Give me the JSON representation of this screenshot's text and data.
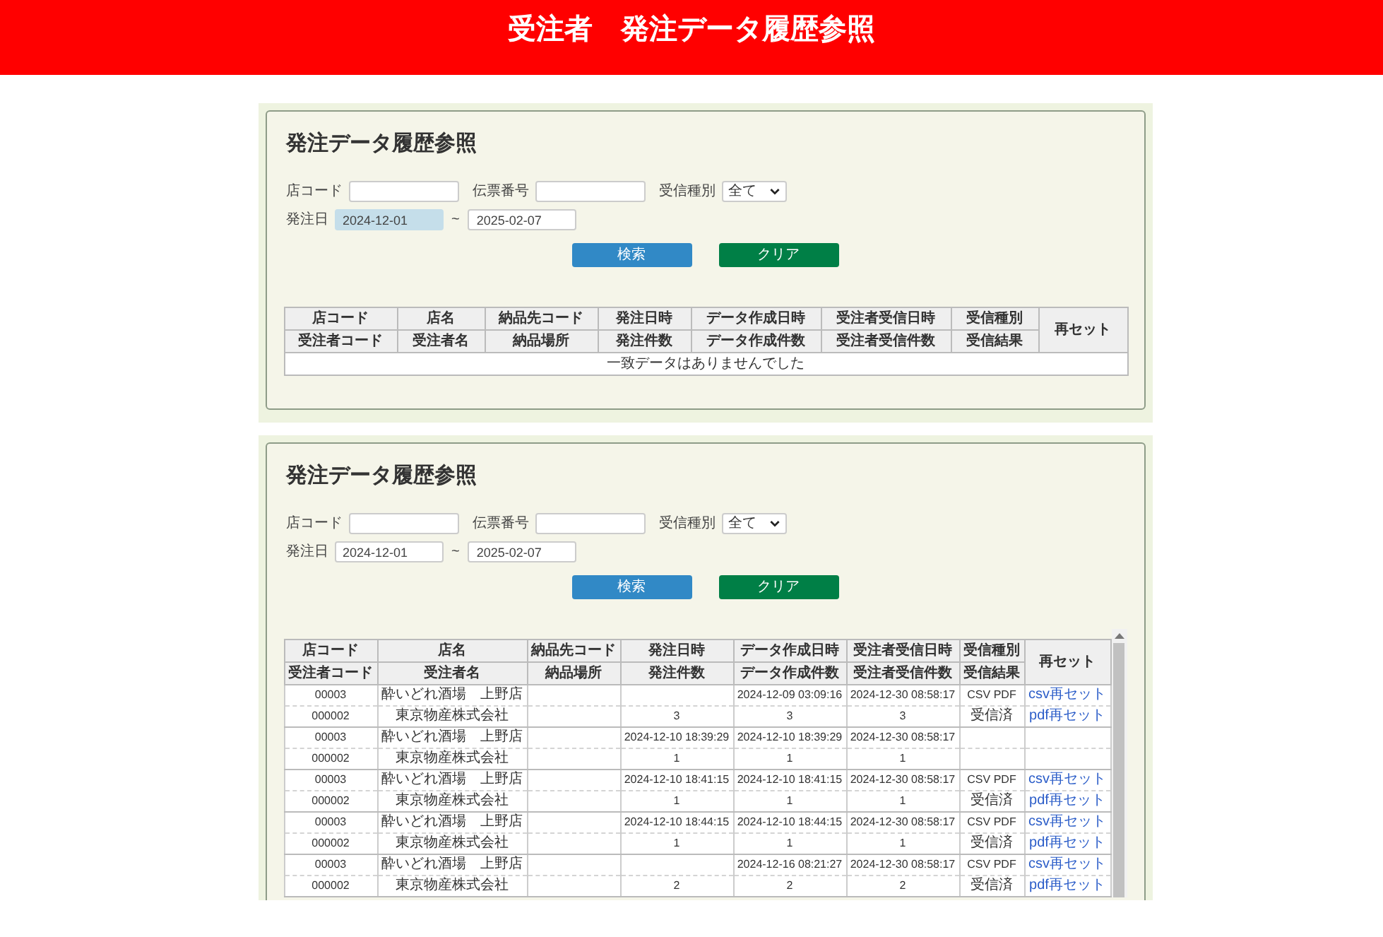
{
  "header": {
    "title": "受注者　発注データ履歴参照"
  },
  "panels": [
    {
      "title": "発注データ履歴参照",
      "filters": [
        {
          "kind": "text",
          "label": "店コード"
        },
        {
          "kind": "text",
          "label": "伝票番号"
        },
        {
          "kind": "select",
          "label": "受信種別",
          "value": "全て"
        }
      ],
      "date_range": {
        "label": "発注日",
        "from": {
          "value": "2024-12-01",
          "highlighted": true
        },
        "separator": "~",
        "to": {
          "value": "2025-02-07",
          "highlighted": false
        }
      },
      "buttons": [
        {
          "kind": "search",
          "label": "検索"
        },
        {
          "kind": "clear",
          "label": "クリア"
        }
      ],
      "table": {
        "columns": [
          {
            "top": "店コード",
            "bottom": "受注者コード"
          },
          {
            "top": "店名",
            "bottom": "受注者名"
          },
          {
            "top": "納品先コード",
            "bottom": "納品場所"
          },
          {
            "top": "発注日時",
            "bottom": "発注件数"
          },
          {
            "top": "データ作成日時",
            "bottom": "データ作成件数"
          },
          {
            "top": "受注者受信日時",
            "bottom": "受注者受信件数"
          },
          {
            "top": "受信種別",
            "bottom": "受信結果"
          },
          {
            "top": "再セット"
          }
        ],
        "empty_message": "一致データはありませんでした"
      }
    },
    {
      "title": "発注データ履歴参照",
      "filters": [
        {
          "kind": "text",
          "label": "店コード"
        },
        {
          "kind": "text",
          "label": "伝票番号"
        },
        {
          "kind": "select",
          "label": "受信種別",
          "value": "全て"
        }
      ],
      "date_range": {
        "label": "発注日",
        "from": {
          "value": "2024-12-01",
          "highlighted": false
        },
        "separator": "~",
        "to": {
          "value": "2025-02-07",
          "highlighted": false
        }
      },
      "buttons": [
        {
          "kind": "search",
          "label": "検索"
        },
        {
          "kind": "clear",
          "label": "クリア"
        }
      ],
      "table": {
        "columns": [
          {
            "top": "店コード",
            "bottom": "受注者コード"
          },
          {
            "top": "店名",
            "bottom": "受注者名"
          },
          {
            "top": "納品先コード",
            "bottom": "納品場所"
          },
          {
            "top": "発注日時",
            "bottom": "発注件数"
          },
          {
            "top": "データ作成日時",
            "bottom": "データ作成件数"
          },
          {
            "top": "受注者受信日時",
            "bottom": "受注者受信件数"
          },
          {
            "top": "受信種別",
            "bottom": "受信結果"
          },
          {
            "top": "再セット"
          }
        ],
        "records": [
          {
            "store_code": "00003",
            "store_name": "酔いどれ酒場　上野店",
            "created_datetime": "2024-12-09 03:09:16",
            "received_datetime": "2024-12-30 08:58:17",
            "receive_type": "CSV PDF",
            "csv_reset_link": "csv再セット",
            "receiver_code": "000002",
            "receiver_name": "東京物産株式会社",
            "order_count": "3",
            "created_count": "3",
            "received_count": "3",
            "receive_result": "受信済",
            "pdf_reset_link": "pdf再セット"
          },
          {
            "store_code": "00003",
            "store_name": "酔いどれ酒場　上野店",
            "order_datetime": "2024-12-10 18:39:29",
            "created_datetime": "2024-12-10 18:39:29",
            "received_datetime": "2024-12-30 08:58:17",
            "receiver_code": "000002",
            "receiver_name": "東京物産株式会社",
            "order_count": "1",
            "created_count": "1",
            "received_count": "1"
          },
          {
            "store_code": "00003",
            "store_name": "酔いどれ酒場　上野店",
            "order_datetime": "2024-12-10 18:41:15",
            "created_datetime": "2024-12-10 18:41:15",
            "received_datetime": "2024-12-30 08:58:17",
            "receive_type": "CSV PDF",
            "csv_reset_link": "csv再セット",
            "receiver_code": "000002",
            "receiver_name": "東京物産株式会社",
            "order_count": "1",
            "created_count": "1",
            "received_count": "1",
            "receive_result": "受信済",
            "pdf_reset_link": "pdf再セット"
          },
          {
            "store_code": "00003",
            "store_name": "酔いどれ酒場　上野店",
            "order_datetime": "2024-12-10 18:44:15",
            "created_datetime": "2024-12-10 18:44:15",
            "received_datetime": "2024-12-30 08:58:17",
            "receive_type": "CSV PDF",
            "csv_reset_link": "csv再セット",
            "receiver_code": "000002",
            "receiver_name": "東京物産株式会社",
            "order_count": "1",
            "created_count": "1",
            "received_count": "1",
            "receive_result": "受信済",
            "pdf_reset_link": "pdf再セット"
          },
          {
            "store_code": "00003",
            "store_name": "酔いどれ酒場　上野店",
            "created_datetime": "2024-12-16 08:21:27",
            "received_datetime": "2024-12-30 08:58:17",
            "receive_type": "CSV PDF",
            "csv_reset_link": "csv再セット",
            "receiver_code": "000002",
            "receiver_name": "東京物産株式会社",
            "order_count": "2",
            "created_count": "2",
            "received_count": "2",
            "receive_result": "受信済",
            "pdf_reset_link": "pdf再セット"
          }
        ]
      }
    }
  ]
}
